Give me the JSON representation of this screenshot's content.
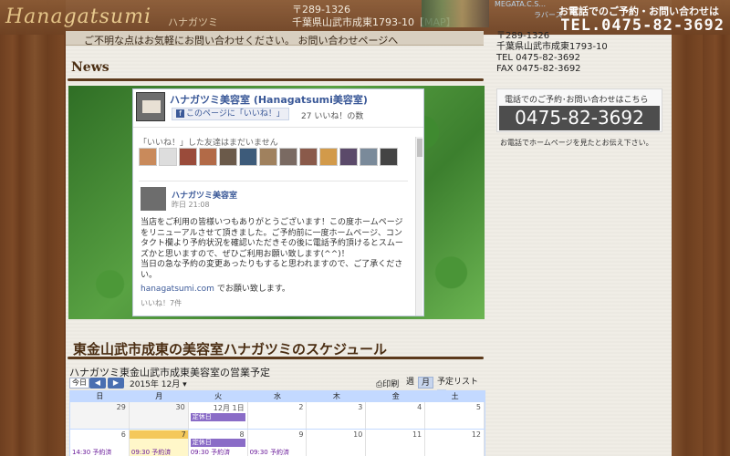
{
  "header": {
    "logo": "Hanagatsumi",
    "logo_kana": "ハナガツミ",
    "postal": "〒289-1326",
    "address_line": "千葉県山武市成東1793-10【MAP】",
    "mini_text": "MEGATA.C.S...",
    "mini_text2": "ラバース",
    "tel_note": "お電話でのご予約・お問い合わせは",
    "tel": "TEL.0475-82-3692"
  },
  "notice": "ご不明な点はお気軽にお問い合わせください。 お問い合わせページへ",
  "news": {
    "title": "News",
    "facebook": {
      "page_name": "ハナガツミ美容室 (Hanagatsumi美容室)",
      "like_button": "このページに「いいね！」",
      "likes_count": "27 いいね！の数",
      "friends_text": "「いいね！」した友達はまだいません",
      "post": {
        "author": "ハナガツミ美容室",
        "time": "昨日 21:08",
        "text": "当店をご利用の皆様いつもありがとうございます！この度ホームページをリニューアルさせて頂きました。ご予約前に一度ホームページ、コンタクト欄より予約状況を確認いただきその後に電話予約頂けるとスムーズかと思いますので、ぜひご利用お願い致します(^^)！\n当日の急な予約の変更あったりもすると思われますので、ご了承ください。",
        "link_url": "hanagatsumi.com",
        "link_suffix": " でお願い致します。",
        "likes": "いいね！7件"
      }
    }
  },
  "schedule": {
    "title": "東金山武市成東の美容室ハナガツミのスケジュール",
    "calendar_title": "ハナガツミ東金山武市成東美容室の営業予定",
    "today_button": "今日",
    "prev": "◀",
    "next": "▶",
    "month": "2015年 12月",
    "print": "印刷",
    "tabs": [
      "週",
      "月",
      "予定リスト"
    ],
    "weekdays": [
      "日",
      "月",
      "火",
      "水",
      "木",
      "金",
      "土"
    ],
    "rows": [
      {
        "days": [
          "29",
          "30",
          "12月 1日",
          "2",
          "3",
          "4",
          "5"
        ],
        "other": [
          true,
          true,
          false,
          false,
          false,
          false,
          false
        ]
      },
      {
        "days": [
          "6",
          "7",
          "8",
          "9",
          "10",
          "11",
          "12"
        ],
        "other": [
          false,
          false,
          false,
          false,
          false,
          false,
          false
        ]
      }
    ],
    "events": {
      "row0_tue": "定休日",
      "row1_tue": "定休日"
    },
    "event_lines": {
      "sun": "14:30 予約済",
      "mon": "09:30 予約済",
      "tue": "09:30 予約済",
      "wed": "09:30 予約済"
    }
  },
  "sidebar": {
    "postal": "〒289-1326",
    "address": "千葉県山武市成東1793-10",
    "tel": "TEL 0475-82-3692",
    "fax": "FAX 0475-82-3692",
    "tel_box_note": "電話でのご予約･お問い合わせはこちら",
    "tel_box_number": "0475-82-3692",
    "tel_box_sub": "お電話でホームページを見たとお伝え下さい。"
  }
}
